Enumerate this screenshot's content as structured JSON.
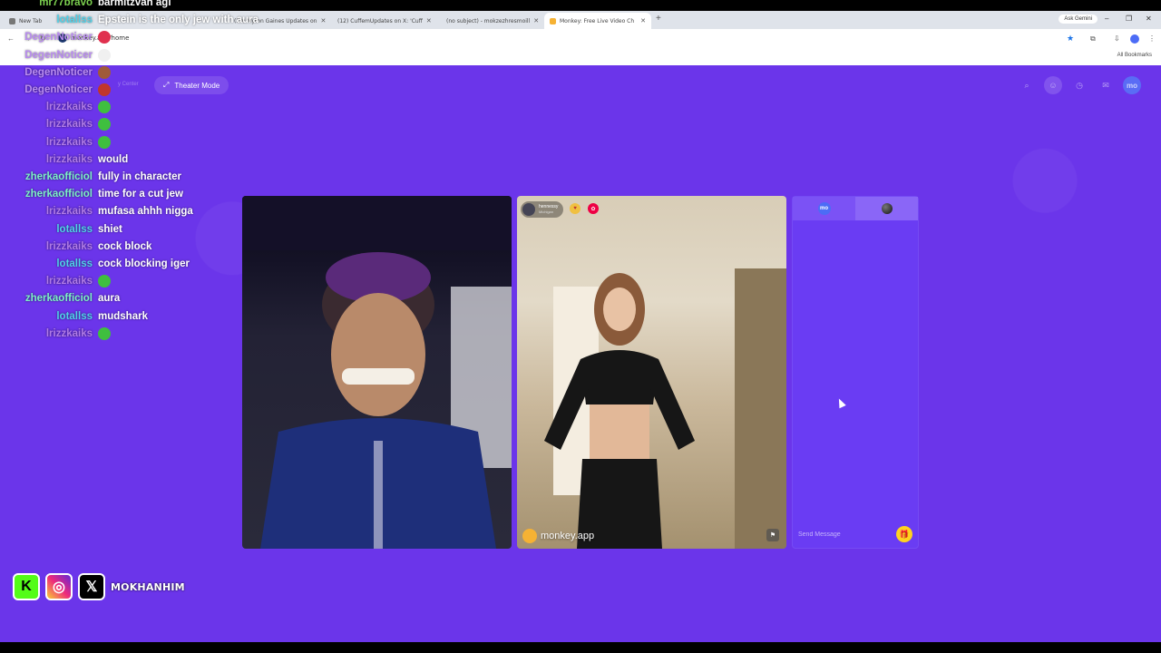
{
  "browser": {
    "tabs": [
      {
        "label": "New Tab"
      },
      {
        "label": "(10) Myron Gaines Updates on"
      },
      {
        "label": "(12) CuffemUpdates on X: 'Cuff"
      },
      {
        "label": "(no subject) - mokzezhresmoill"
      },
      {
        "label": "Monkey: Free Live Video Ch"
      }
    ],
    "ask_gemini": "Ask Gemini",
    "url": "monkey.app/home",
    "all_bookmarks": "All Bookmarks"
  },
  "app": {
    "theater_mode": "Theater Mode",
    "faded_nav": "y Center",
    "top_avatar": "mo",
    "partner": {
      "name": "hennessy",
      "location": "Michigan"
    },
    "watermark": "monkey.app",
    "chat_tab_avatar": "mo",
    "send_placeholder": "Send Message"
  },
  "stream_chat": [
    {
      "user": "mr77bravo",
      "msg": "barmitzvah agi",
      "color": "#7cd14f",
      "emote": ""
    },
    {
      "user": "lotallss",
      "msg": "Epstein is the only jew with aura",
      "color": "#4fd1e8",
      "emote": ""
    },
    {
      "user": "DegenNoticer",
      "msg": "",
      "color": "#b98cf0",
      "emote": "#e0304e"
    },
    {
      "user": "DegenNoticer",
      "msg": "",
      "color": "#b98cf0",
      "emote": "#f0f0f0"
    },
    {
      "user": "DegenNoticer",
      "msg": "",
      "color": "#b98cf0",
      "emote": "#a05a3a"
    },
    {
      "user": "DegenNoticer",
      "msg": "",
      "color": "#b98cf0",
      "emote": "#c0362c"
    },
    {
      "user": "lrizzkaiks",
      "msg": "",
      "color": "#b07be8",
      "emote": "#3fbf3f"
    },
    {
      "user": "lrizzkaiks",
      "msg": "",
      "color": "#b07be8",
      "emote": "#3fbf3f"
    },
    {
      "user": "lrizzkaiks",
      "msg": "",
      "color": "#b07be8",
      "emote": "#3fbf3f"
    },
    {
      "user": "lrizzkaiks",
      "msg": "would",
      "color": "#b07be8",
      "emote": ""
    },
    {
      "user": "zherkaofficiol",
      "msg": "fully in character",
      "color": "#7df0c8",
      "emote": ""
    },
    {
      "user": "zherkaofficiol",
      "msg": "time for a cut jew",
      "color": "#7df0c8",
      "emote": ""
    },
    {
      "user": "lrizzkaiks",
      "msg": "mufasa ahhh nigga",
      "color": "#b07be8",
      "emote": ""
    },
    {
      "user": "lotallss",
      "msg": "shiet",
      "color": "#4fd1e8",
      "emote": ""
    },
    {
      "user": "lrizzkaiks",
      "msg": "cock block",
      "color": "#b07be8",
      "emote": ""
    },
    {
      "user": "lotallss",
      "msg": "cock blocking iger",
      "color": "#4fd1e8",
      "emote": ""
    },
    {
      "user": "lrizzkaiks",
      "msg": "",
      "color": "#b07be8",
      "emote": "#3fbf3f"
    },
    {
      "user": "zherkaofficiol",
      "msg": "aura",
      "color": "#7df0c8",
      "emote": ""
    },
    {
      "user": "lotallss",
      "msg": "mudshark",
      "color": "#4fd1e8",
      "emote": ""
    },
    {
      "user": "lrizzkaiks",
      "msg": "",
      "color": "#b07be8",
      "emote": "#3fbf3f"
    }
  ],
  "socials": {
    "handle": "MOKHANHIM"
  }
}
